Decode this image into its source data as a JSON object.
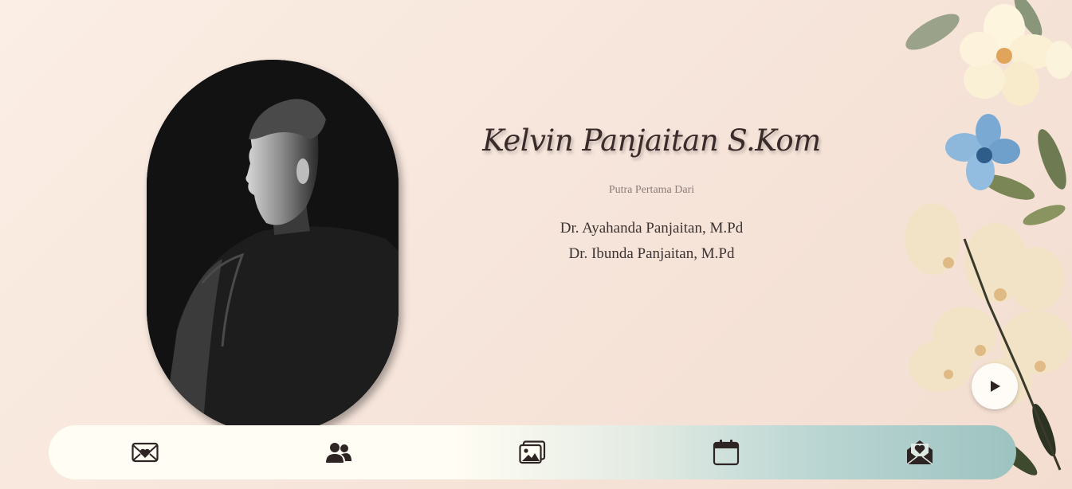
{
  "profile": {
    "name": "Kelvin Panjaitan S.Kom",
    "subtitle": "Putra Pertama Dari",
    "father": "Dr. Ayahanda Panjaitan, M.Pd",
    "mother": "Dr. Ibunda Panjaitan, M.Pd"
  },
  "nav": {
    "items": [
      {
        "icon": "envelope-heart-icon"
      },
      {
        "icon": "users-icon"
      },
      {
        "icon": "gallery-icon"
      },
      {
        "icon": "calendar-icon"
      },
      {
        "icon": "open-envelope-heart-icon"
      }
    ]
  },
  "audio": {
    "icon": "play-icon"
  },
  "colors": {
    "icon": "#2f2424",
    "name_text": "#3a2a2a",
    "nav_start": "#fffdf4",
    "nav_end": "#9dc3c1"
  }
}
